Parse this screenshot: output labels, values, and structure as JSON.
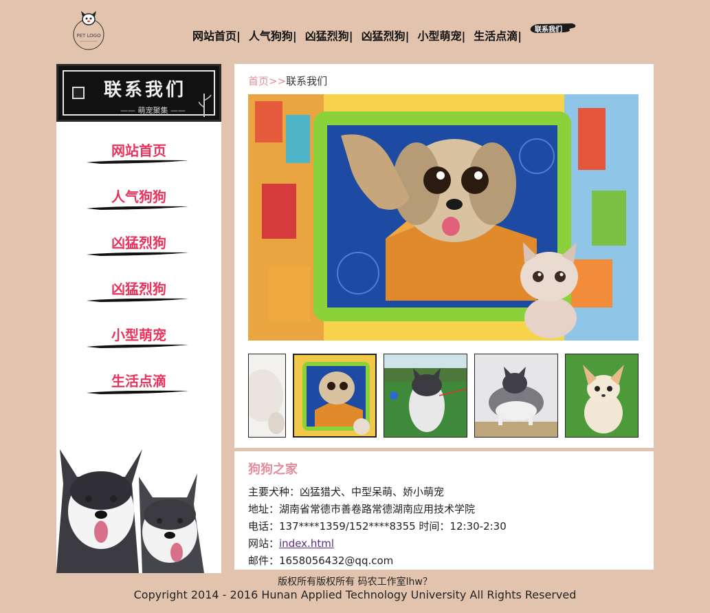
{
  "header": {
    "logo_text": "PET LOGO",
    "nav": [
      {
        "label": "网站首页|"
      },
      {
        "label": "人气狗狗|"
      },
      {
        "label": "凶猛烈狗|"
      },
      {
        "label": "凶猛烈狗|"
      },
      {
        "label": "小型萌宠|"
      },
      {
        "label": "生活点滴|"
      }
    ],
    "contact_label": "联系我们"
  },
  "sidebar": {
    "banner_title": "联系我们",
    "banner_subtitle": "—— 萌宠聚集 ——",
    "items": [
      {
        "label": "网站首页"
      },
      {
        "label": "人气狗狗"
      },
      {
        "label": "凶猛烈狗"
      },
      {
        "label": "凶猛烈狗"
      },
      {
        "label": "小型萌宠"
      },
      {
        "label": "生活点滴"
      }
    ]
  },
  "breadcrumb": {
    "home": "首页",
    "separator": ">>",
    "current": "联系我们"
  },
  "info": {
    "title": "狗狗之家",
    "breeds": "主要犬种：凶猛猎犬、中型呆萌、娇小萌宠",
    "address": "地址：湖南省常德市善卷路常德湖南应用技术学院",
    "phone": "电话：137****1359/152****8355 时间：12:30-2:30",
    "website_label": "网站：",
    "website_link": "index.html",
    "email": "邮件：1658056432@qq.com"
  },
  "footer": {
    "line1": "版权所有版权所有 码农工作室lhw？",
    "line2": "Copyright 2014 - 2016 Hunan Applied Technology University All Rights Reserved"
  },
  "colors": {
    "background": "#e2c4ae",
    "accent_pink": "#e8335c",
    "soft_pink": "#e58c9a",
    "link_purple": "#5b2c8a"
  }
}
